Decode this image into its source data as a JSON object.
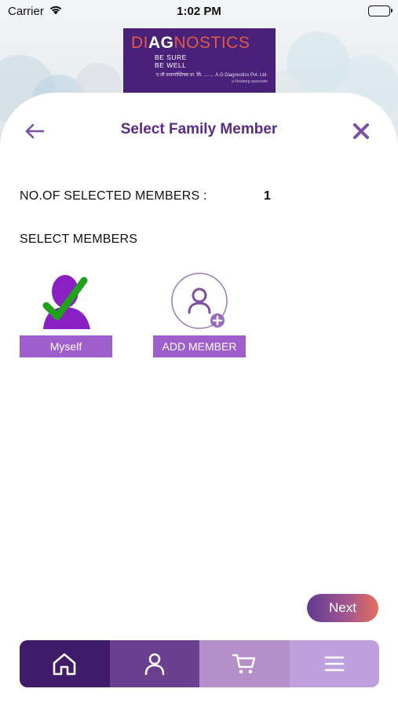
{
  "status_bar": {
    "carrier": "Carrier",
    "time": "1:02 PM"
  },
  "logo": {
    "word_part1": "DI",
    "word_part2": "AG",
    "word_part3": "NOSTICS",
    "tagline_1": "BE SURE",
    "tagline_2": "BE WELL",
    "company": "ए.जी डायग्नोस्टिक्स प्रा. लि. ........ A.G Diagnostics Pvt. Ltd.",
    "associate": "a Neuberg associate"
  },
  "header": {
    "title": "Select Family Member",
    "back_icon": "arrow-left-icon",
    "close_icon": "close-icon"
  },
  "selection": {
    "count_label": "NO.OF SELECTED MEMBERS :",
    "count_value": "1",
    "section_label": "SELECT MEMBERS"
  },
  "members": [
    {
      "label": "Myself",
      "icon": "person-checked-icon",
      "selected": true
    },
    {
      "label": "ADD MEMBER",
      "icon": "add-person-icon",
      "selected": false
    }
  ],
  "next_label": "Next",
  "tabs": [
    {
      "name": "home",
      "icon": "home-icon",
      "color": "#3f1b69"
    },
    {
      "name": "profile",
      "icon": "user-icon",
      "color": "#6a3f8f"
    },
    {
      "name": "cart",
      "icon": "cart-icon",
      "color": "#b391c8"
    },
    {
      "name": "menu",
      "icon": "menu-icon",
      "color": "#bea0dc"
    }
  ],
  "colors": {
    "accent": "#5b2c86",
    "button": "#9e5fcd",
    "check": "#22a11c"
  }
}
